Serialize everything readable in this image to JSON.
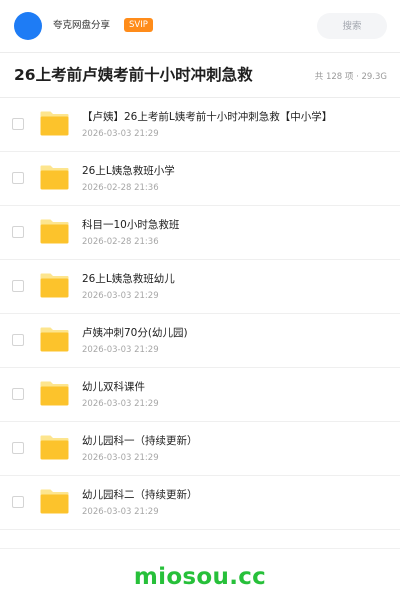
{
  "header": {
    "app_name": "夸克网盘分享",
    "badge": "SVIP",
    "search_placeholder": "搜索"
  },
  "folder": {
    "title": "26上考前卢姨考前十小时冲刺急救",
    "summary": "共 128 项 · 29.3G"
  },
  "items": [
    {
      "name": "【卢姨】26上考前L姨考前十小时冲刺急救【中小学】",
      "date": "2026-03-03 21:29"
    },
    {
      "name": "26上L姨急救班小学",
      "date": "2026-02-28 21:36"
    },
    {
      "name": "科目一10小时急救班",
      "date": "2026-02-28 21:36"
    },
    {
      "name": "26上L姨急救班幼儿",
      "date": "2026-03-03 21:29"
    },
    {
      "name": "卢姨冲刺70分(幼儿园)",
      "date": "2026-03-03 21:29"
    },
    {
      "name": "幼儿双科课件",
      "date": "2026-03-03 21:29"
    },
    {
      "name": "幼儿园科一（持续更新）",
      "date": "2026-03-03 21:29"
    },
    {
      "name": "幼儿园科二（持续更新）",
      "date": "2026-03-03 21:29"
    }
  ],
  "footer": {
    "watermark": "miosou.cc"
  },
  "colors": {
    "accent": "#1e7cf5",
    "badge": "#ff8c1a",
    "folder": "#fcc32c",
    "watermark": "#27c03a"
  },
  "icons": {
    "avatar": "avatar",
    "folder": "folder-icon",
    "checkbox": "checkbox"
  }
}
